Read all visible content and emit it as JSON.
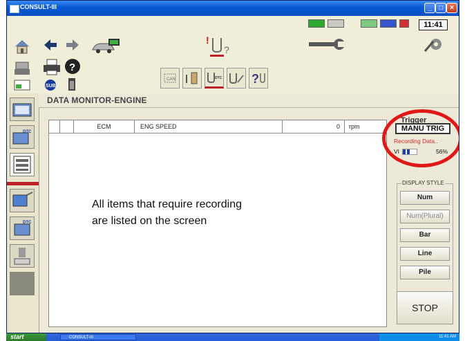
{
  "window": {
    "title": "CONSULT-III"
  },
  "status": {
    "clock": "11:41"
  },
  "page": {
    "title": "DATA MONITOR-ENGINE"
  },
  "table": {
    "rows": [
      {
        "system": "ECM",
        "item": "ENG SPEED",
        "value": "0",
        "unit": "rpm"
      }
    ]
  },
  "note": {
    "line1": "All items that require recording",
    "line2": "are listed on the screen"
  },
  "trigger": {
    "label": "Trigger",
    "manual_button": "MANU TRIG",
    "recording_text": "Recording Data..",
    "vi_label": "VI",
    "vi_percent": "56%",
    "vi_progress": 0.56
  },
  "display_style": {
    "legend": "DISPLAY STYLE",
    "buttons": [
      "Num",
      "Num(Plural)",
      "Bar",
      "Line",
      "Pile"
    ]
  },
  "stop_button": "STOP",
  "taskbar": {
    "start": "start",
    "task": "CONSULT-III",
    "tray_time": "11:41 AM"
  },
  "colors": {
    "title_bar": "#0b5ad8",
    "highlight_ellipse": "#e01818",
    "recording_text": "#d12a2a",
    "accent_red": "#c0202a"
  }
}
